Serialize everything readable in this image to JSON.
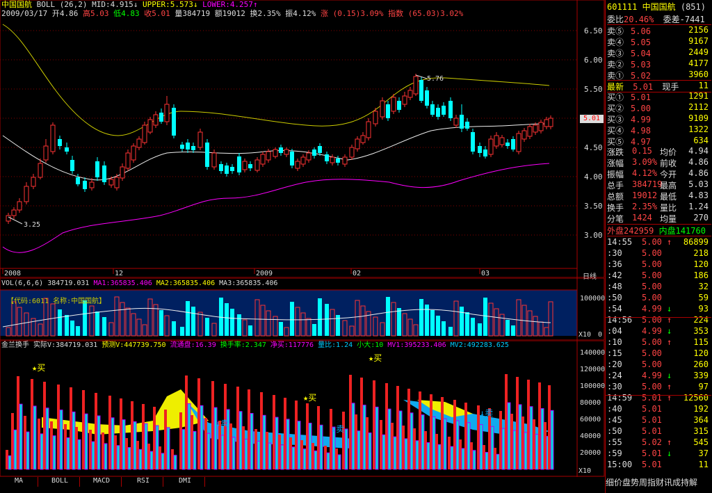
{
  "header": {
    "stock_name": "中国国航",
    "indicator": "BOLL (26,2)",
    "mid": "MID:4.915↓",
    "upper": "UPPER:5.573↓",
    "lower": "LOWER:4.257↑",
    "date": "2009/03/17",
    "open": "开4.86",
    "high": "高5.03",
    "low": "低4.83",
    "close": "收5.01",
    "volume": "量384719",
    "amount": "额19012",
    "turnover": "换2.35%",
    "amplitude": "振4.12%",
    "change": "涨 (0.15)3.09%",
    "index": "指数 (65.03)3.02%"
  },
  "price_axis": [
    "6.50",
    "6.00",
    "5.50",
    "5.00",
    "4.50",
    "4.00",
    "3.50",
    "3.00"
  ],
  "annotations": {
    "low_label": "3.25",
    "high_label": "5.76",
    "current_price": "5.01"
  },
  "date_axis": {
    "labels": [
      "2008",
      "12",
      "2009",
      "02",
      "03"
    ],
    "right_label": "日线"
  },
  "vol_panel": {
    "title": "VOL(6,6,6)",
    "vol": "384719.031",
    "ma1": "MA1:365835.406",
    "ma2": "MA2:365835.406",
    "ma3": "MA3:365835.406",
    "code_label": "【代码:6011",
    "name_label": "名称:中国国航】",
    "axis": [
      "100000",
      "0"
    ],
    "unit": "X10"
  },
  "jl_panel": {
    "title": "金兰换手",
    "actual": "实际V:384719.031",
    "predict": "预测V:447739.750",
    "float_cap": "流通盘:16.39",
    "turnover_rate": "换手率:2.347",
    "net_buy": "净买:117776",
    "vol_ratio": "量比:1.24",
    "small_big": "小大:10",
    "mv1": "MV1:395233.406",
    "mv2": "MV2:492283.625",
    "axis": [
      "140000",
      "120000",
      "100000",
      "80000",
      "60000",
      "40000",
      "20000"
    ],
    "unit": "X10",
    "signals": [
      "★买",
      "★买",
      "★买",
      "↓卖",
      "↓卖",
      "↓卖"
    ]
  },
  "tabs": [
    "MA",
    "BOLL",
    "MACD",
    "RSI",
    "DMI"
  ],
  "side": {
    "code": "601111",
    "name": "中国国航",
    "num": "(851)",
    "weibi": "委比",
    "weibi_val": "20.46%",
    "weicha": "委差",
    "weicha_val": "-7441",
    "asks": [
      {
        "label": "卖⑤",
        "price": "5.06",
        "vol": "2156"
      },
      {
        "label": "卖④",
        "price": "5.05",
        "vol": "9167"
      },
      {
        "label": "卖③",
        "price": "5.04",
        "vol": "2449"
      },
      {
        "label": "卖②",
        "price": "5.03",
        "vol": "4177"
      },
      {
        "label": "卖①",
        "price": "5.02",
        "vol": "3960"
      }
    ],
    "last": {
      "label": "最新",
      "price": "5.01",
      "hand_label": "现手",
      "hand": "11"
    },
    "bids": [
      {
        "label": "买①",
        "price": "5.01",
        "vol": "1291"
      },
      {
        "label": "买②",
        "price": "5.00",
        "vol": "2112"
      },
      {
        "label": "买③",
        "price": "4.99",
        "vol": "9109"
      },
      {
        "label": "买④",
        "price": "4.98",
        "vol": "1322"
      },
      {
        "label": "买⑤",
        "price": "4.97",
        "vol": "634"
      }
    ],
    "stats": [
      {
        "l1": "涨跌",
        "v1": "0.15",
        "l2": "均价",
        "v2": "4.94"
      },
      {
        "l1": "涨幅",
        "v1": "3.09%",
        "l2": "前收",
        "v2": "4.86"
      },
      {
        "l1": "振幅",
        "v1": "4.12%",
        "l2": "今开",
        "v2": "4.86"
      },
      {
        "l1": "总手",
        "v1": "384719",
        "l2": "最高",
        "v2": "5.03"
      },
      {
        "l1": "总额",
        "v1": "19012",
        "l2": "最低",
        "v2": "4.83"
      },
      {
        "l1": "换手",
        "v1": "2.35%",
        "l2": "量比",
        "v2": "1.24"
      },
      {
        "l1": "分笔",
        "v1": "1424",
        "l2": "均量",
        "v2": "270"
      }
    ],
    "outer": "外盘242959",
    "inner": "内盘141760",
    "ticks": [
      {
        "t": "14:55",
        "p": "5.00",
        "a": "↑",
        "v": "86899"
      },
      {
        "t": ":30",
        "p": "5.00",
        "a": "",
        "v": "218"
      },
      {
        "t": ":36",
        "p": "5.00",
        "a": "",
        "v": "120"
      },
      {
        "t": ":42",
        "p": "5.00",
        "a": "",
        "v": "186"
      },
      {
        "t": ":48",
        "p": "5.00",
        "a": "",
        "v": "32"
      },
      {
        "t": ":50",
        "p": "5.00",
        "a": "",
        "v": "59"
      },
      {
        "t": ":54",
        "p": "4.99",
        "a": "↓",
        "v": "93"
      },
      {
        "t": "14:56",
        "p": "5.00",
        "a": "↑",
        "v": "224"
      },
      {
        "t": ":04",
        "p": "4.99",
        "a": "↓",
        "v": "353"
      },
      {
        "t": ":10",
        "p": "5.00",
        "a": "↑",
        "v": "115"
      },
      {
        "t": ":15",
        "p": "5.00",
        "a": "",
        "v": "120"
      },
      {
        "t": ":20",
        "p": "5.00",
        "a": "",
        "v": "260"
      },
      {
        "t": ":24",
        "p": "4.99",
        "a": "↓",
        "v": "339"
      },
      {
        "t": ":30",
        "p": "5.00",
        "a": "↑",
        "v": "97"
      },
      {
        "t": "14:59",
        "p": "5.01",
        "a": "↑",
        "v": "12560"
      },
      {
        "t": ":40",
        "p": "5.01",
        "a": "",
        "v": "192"
      },
      {
        "t": ":45",
        "p": "5.01",
        "a": "",
        "v": "364"
      },
      {
        "t": ":50",
        "p": "5.01",
        "a": "",
        "v": "315"
      },
      {
        "t": ":55",
        "p": "5.02",
        "a": "↑",
        "v": "545"
      },
      {
        "t": ":59",
        "p": "5.01",
        "a": "↓",
        "v": "37"
      },
      {
        "t": "15:00",
        "p": "5.01",
        "a": "",
        "v": "11"
      }
    ],
    "footer": "细价盘势周指财讯成持解"
  }
}
